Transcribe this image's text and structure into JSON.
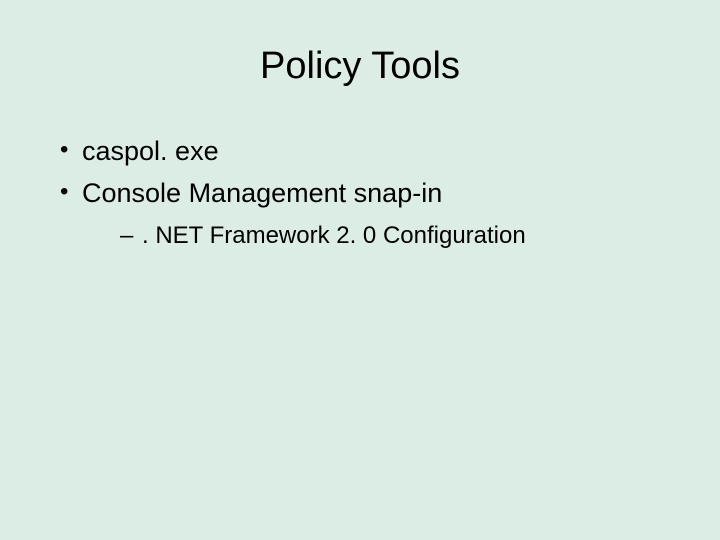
{
  "slide": {
    "title": "Policy Tools",
    "bullets": [
      {
        "text": "caspol. exe"
      },
      {
        "text": "Console Management snap-in"
      }
    ],
    "subbullets": [
      {
        "text": ". NET Framework 2. 0 Configuration"
      }
    ]
  }
}
